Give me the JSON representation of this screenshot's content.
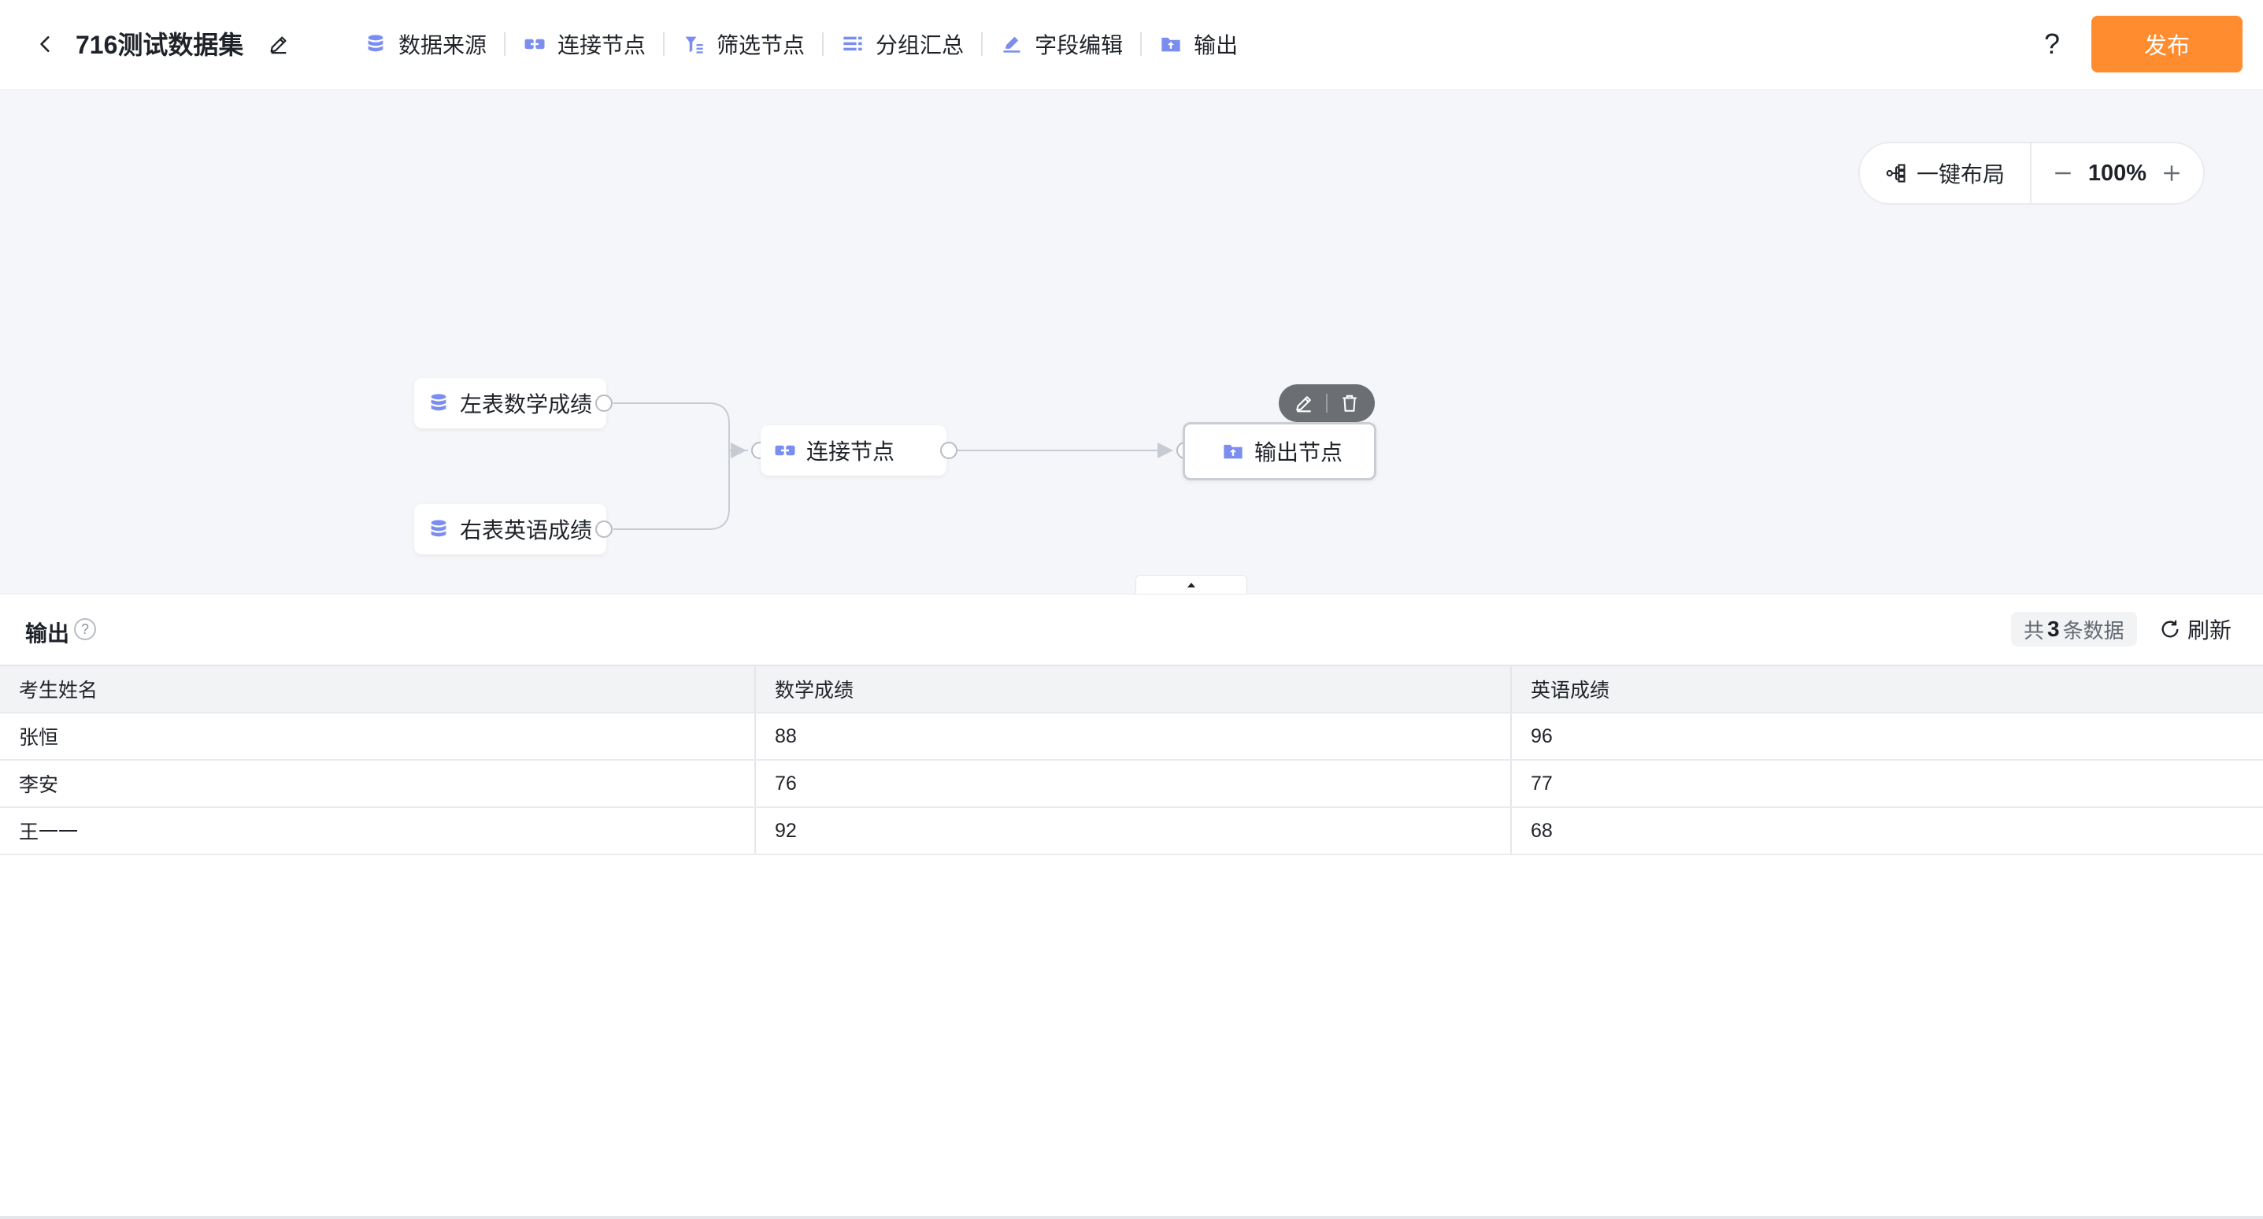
{
  "header": {
    "title": "716测试数据集",
    "publish_label": "发布",
    "help_label": "?"
  },
  "toolbar": {
    "items": [
      {
        "label": "数据来源",
        "icon": "database-icon"
      },
      {
        "label": "连接节点",
        "icon": "join-icon"
      },
      {
        "label": "筛选节点",
        "icon": "filter-icon"
      },
      {
        "label": "分组汇总",
        "icon": "group-icon"
      },
      {
        "label": "字段编辑",
        "icon": "pen-icon"
      },
      {
        "label": "输出",
        "icon": "output-folder-icon"
      }
    ]
  },
  "canvas": {
    "auto_layout_label": "一键布局",
    "zoom_level": "100%",
    "nodes": {
      "left_table": "左表数学成绩",
      "right_table": "右表英语成绩",
      "join": "连接节点",
      "output": "输出节点"
    }
  },
  "output_panel": {
    "title": "输出",
    "count_prefix": "共",
    "count_value": "3",
    "count_suffix": "条数据",
    "refresh_label": "刷新",
    "columns": [
      "考生姓名",
      "数学成绩",
      "英语成绩"
    ],
    "rows": [
      [
        "张恒",
        "88",
        "96"
      ],
      [
        "李安",
        "76",
        "77"
      ],
      [
        "王一一",
        "92",
        "68"
      ]
    ]
  },
  "colors": {
    "accent": "#ff8c2e",
    "icon": "#7b8ef0",
    "canvas_bg": "#f5f6f9"
  }
}
